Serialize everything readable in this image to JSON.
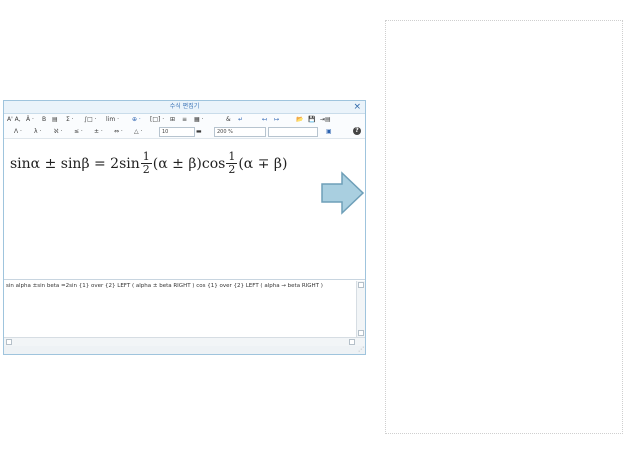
{
  "window": {
    "title": "수식 편집기",
    "close_label": "×"
  },
  "toolbar1": {
    "items": [
      "A' A,",
      "Ä ·",
      "B",
      "▤",
      "Σ ·",
      "∫□ ·",
      "lim ·",
      "⊕ ·",
      "[□] ·",
      "⊞",
      "≡",
      "▦ ·",
      "&",
      "↵",
      "↤",
      "↦",
      "📂",
      "💾",
      "⇥▤"
    ]
  },
  "toolbar2": {
    "items": [
      "Λ ·",
      "λ ·",
      "ℵ ·",
      "≤ ·",
      "± ·",
      "⇔ ·",
      "△ ·"
    ],
    "font_size": "10",
    "zoom": "200 %",
    "color_swatch": "▬",
    "help_label": "?"
  },
  "formula": {
    "part1": "sinα ± sinβ = 2sin",
    "frac1_num": "1",
    "frac1_den": "2",
    "part2": "(α ± β)cos",
    "frac2_num": "1",
    "frac2_den": "2",
    "part3": "(α ∓ β)"
  },
  "script": {
    "text": "sin alpha ±sin beta =2sin {1} over {2} LEFT ( alpha ± beta RIGHT ) cos {1} over {2} LEFT ( alpha → beta RIGHT )"
  },
  "colors": {
    "border": "#9fc4dd",
    "title_text": "#3a73b5",
    "arrow_fill": "#a9cfe0",
    "arrow_stroke": "#6e9fb8"
  }
}
